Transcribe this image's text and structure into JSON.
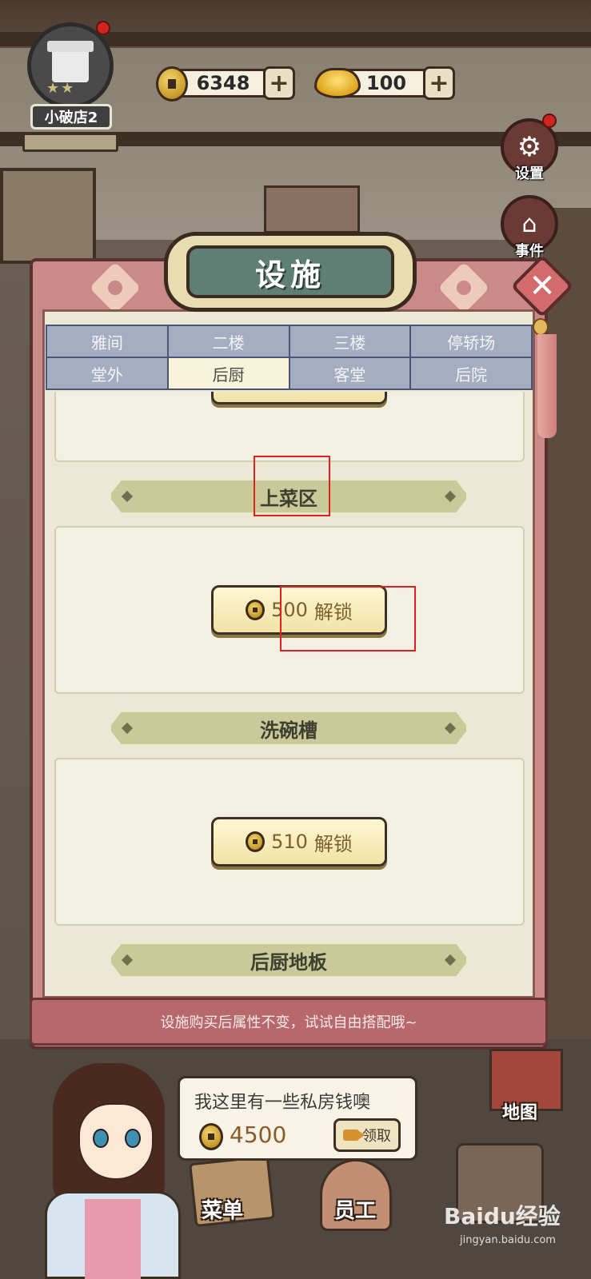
{
  "hud": {
    "shop_name": "小破店2",
    "stars": "★★",
    "copper_coins": "6348",
    "gold_ingots": "100",
    "plus": "+"
  },
  "side_buttons": {
    "settings_label": "设置",
    "events_label": "事件"
  },
  "panel": {
    "title": "设施",
    "close_symbol": "✕",
    "tabs_row1": [
      "雅间",
      "二楼",
      "三楼",
      "停轿场"
    ],
    "tabs_row2": [
      "堂外",
      "后厨",
      "客堂",
      "后院"
    ],
    "active_tab": "后厨",
    "sections": [
      {
        "header": "上菜区",
        "cost": "500",
        "action": "解锁"
      },
      {
        "header": "洗碗槽",
        "cost": "510",
        "action": "解锁"
      },
      {
        "header": "后厨地板"
      }
    ],
    "tip": "设施购买后属性不变，试试自由搭配哦~"
  },
  "speech": {
    "text": "我这里有一些私房钱噢",
    "amount": "4500",
    "claim_label": "领取"
  },
  "bottom_nav": {
    "menu": "菜单",
    "staff": "员工",
    "map": "地图"
  },
  "watermark": {
    "brand": "Baidu经验",
    "url": "jingyan.baidu.com"
  },
  "colors": {
    "panel_pink": "#c98a88",
    "tab_active": "#f7f4da",
    "tab_inactive": "#a5adc2",
    "title_teal": "#5f7e74",
    "highlight_red": "#e02020"
  }
}
